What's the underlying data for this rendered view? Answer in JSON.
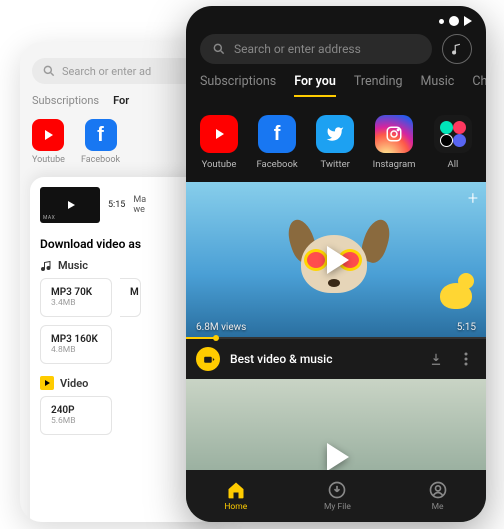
{
  "back": {
    "search_placeholder": "Search or enter ad",
    "tabs": [
      "Subscriptions",
      "For"
    ],
    "quick": [
      {
        "name": "youtube",
        "label": "Youtube"
      },
      {
        "name": "facebook",
        "label": "Facebook"
      }
    ],
    "panel": {
      "thumb_duration": "5:15",
      "meta_line1": "Ma",
      "meta_line2": "we",
      "section_title": "Download video as",
      "music_label": "Music",
      "music_options": [
        {
          "title": "MP3 70K",
          "size": "3.4MB"
        },
        {
          "title": "MP3 160K",
          "size": "4.8MB"
        }
      ],
      "video_label": "Video",
      "video_options": [
        {
          "title": "240P",
          "size": "5.6MB"
        }
      ],
      "more_label": "M"
    }
  },
  "front": {
    "search_placeholder": "Search or enter address",
    "tabs": [
      "Subscriptions",
      "For you",
      "Trending",
      "Music",
      "Chan"
    ],
    "active_tab": 1,
    "quick": [
      {
        "name": "youtube",
        "label": "Youtube"
      },
      {
        "name": "facebook",
        "label": "Facebook"
      },
      {
        "name": "twitter",
        "label": "Twitter"
      },
      {
        "name": "instagram",
        "label": "Instagram"
      },
      {
        "name": "all",
        "label": "All"
      }
    ],
    "feed": {
      "video1": {
        "views": "6.8M views",
        "duration": "5:15"
      },
      "title": "Best video & music"
    },
    "nav": [
      {
        "name": "home",
        "label": "Home"
      },
      {
        "name": "myfile",
        "label": "My File"
      },
      {
        "name": "me",
        "label": "Me"
      }
    ],
    "active_nav": 0
  }
}
